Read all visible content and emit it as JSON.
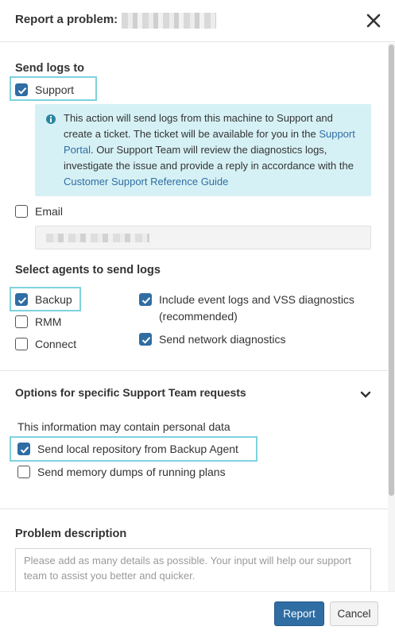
{
  "header": {
    "title": "Report a problem:",
    "title_suffix": "",
    "close_icon": "close-icon"
  },
  "send_logs": {
    "title": "Send logs to",
    "support": {
      "label": "Support",
      "checked": true
    },
    "info": {
      "text_1": "This action will send logs from this machine to Support and create a ticket. The ticket will be available for you in the ",
      "link_portal": "Support Portal",
      "text_2": ". Our Support Team will review the diagnostics logs, investigate the issue and provide a reply in accordance with the ",
      "link_guide": "Customer Support Reference Guide"
    },
    "email": {
      "label": "Email",
      "checked": false,
      "value": ""
    }
  },
  "agents": {
    "title": "Select agents to send logs",
    "backup": {
      "label": "Backup",
      "checked": true
    },
    "rmm": {
      "label": "RMM",
      "checked": false
    },
    "connect": {
      "label": "Connect",
      "checked": false
    },
    "event_logs": {
      "label_1": "Include event logs and VSS diagnostics",
      "label_2": "(recommended)",
      "checked": true
    },
    "network": {
      "label": "Send network diagnostics",
      "checked": true
    }
  },
  "options": {
    "title": "Options for specific Support Team requests",
    "note": "This information may contain personal data",
    "local_repo": {
      "label": "Send local repository from Backup Agent",
      "checked": true
    },
    "memory_dumps": {
      "label": "Send memory dumps of running plans",
      "checked": false
    }
  },
  "problem": {
    "title": "Problem description",
    "placeholder": "Please add as many details as possible. Your input will help our support team to assist you better and quicker."
  },
  "footer": {
    "report_label": "Report",
    "cancel_label": "Cancel"
  },
  "colors": {
    "accent": "#2f6da3",
    "highlight": "#7ed3de",
    "info_bg": "#d6f1f5"
  }
}
